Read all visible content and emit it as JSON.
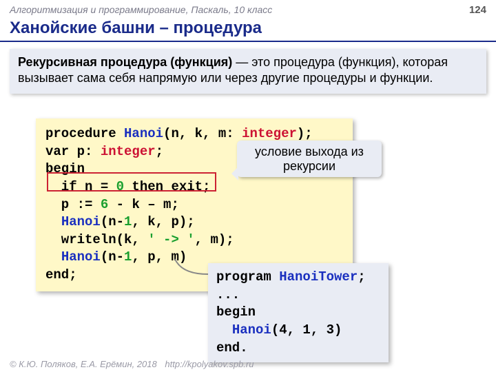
{
  "header": {
    "subject": "Алгоритмизация и программирование, Паскаль, 10 класс",
    "page": "124"
  },
  "title": "Ханойские башни – процедура",
  "definition": {
    "term": "Рекурсивная процедура (функция)",
    "rest": " — это процедура (функция), которая вызывает сама себя напрямую или через другие процедуры и функции."
  },
  "code": {
    "l1a": "procedure ",
    "l1b": "Hanoi",
    "l1c": "(n, k, m: ",
    "l1d": "integer",
    "l1e": ");",
    "l2a": "var p: ",
    "l2b": "integer",
    "l2c": ";",
    "l3": "begin",
    "l4a": "  if n = ",
    "l4b": "0",
    "l4c": " then exit;",
    "l5a": "  p := ",
    "l5b": "6",
    "l5c": " - k – m;",
    "l6a": "  ",
    "l6b": "Hanoi",
    "l6c": "(n-",
    "l6d": "1",
    "l6e": ", k, p);",
    "l7a": "  writeln(k, ",
    "l7b": "' -> '",
    "l7c": ", m);",
    "l8a": "  ",
    "l8b": "Hanoi",
    "l8c": "(n-",
    "l8d": "1",
    "l8e": ", p, m)",
    "l9": "end;"
  },
  "callout1": "условие выхода из рекурсии",
  "program": {
    "l1a": "program ",
    "l1b": "HanoiTower",
    "l1c": ";",
    "l2": "...",
    "l3": "begin",
    "l4a": "  ",
    "l4b": "Hanoi",
    "l4c": "(4, 1, 3)",
    "l5": "end."
  },
  "footer": {
    "copy": "© К.Ю. Поляков, Е.А. Ерёмин, 2018",
    "url": "http://kpolyakov.spb.ru"
  }
}
